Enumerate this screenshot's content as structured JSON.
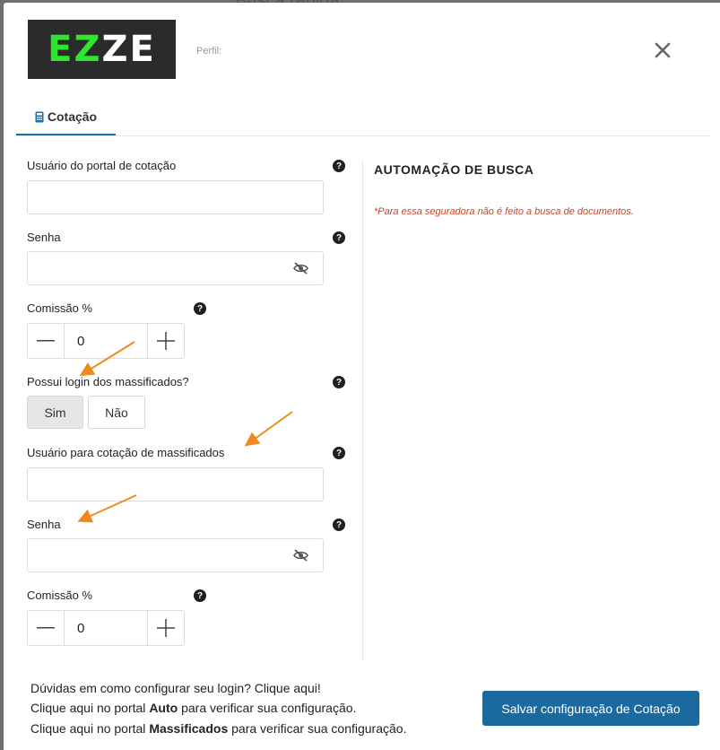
{
  "backdrop": {
    "search_label": "Busca rápida"
  },
  "header": {
    "logo_text_1": "EZ",
    "logo_text_2": "ZE",
    "perfil_label": "Perfil:"
  },
  "tabs": [
    {
      "label": "Cotação",
      "icon": "calculator-icon"
    }
  ],
  "form": {
    "usuario_label": "Usuário do portal de cotação",
    "usuario_value": "",
    "senha_label": "Senha",
    "senha_value": "",
    "comissao_label": "Comissão %",
    "comissao_value": "0",
    "massificados_question": "Possui login dos massificados?",
    "options": [
      "Sim",
      "Não"
    ],
    "selected_option": "Sim",
    "usuario_massificados_label": "Usuário para cotação de massificados",
    "usuario_massificados_value": "",
    "senha2_label": "Senha",
    "senha2_value": "",
    "comissao2_label": "Comissão %",
    "comissao2_value": "0"
  },
  "automation": {
    "title": "AUTOMAÇÃO DE BUSCA",
    "note": "*Para essa seguradora não é feito a busca de documentos."
  },
  "footer": {
    "line1": "Dúvidas em como configurar seu login? Clique aqui!",
    "line2_pre": "Clique aqui no portal ",
    "line2_bold": "Auto",
    "line2_post": " para verificar sua configuração.",
    "line3_pre": "Clique aqui no portal ",
    "line3_bold": "Massificados",
    "line3_post": " para verificar sua configuração.",
    "save_label": "Salvar configuração de Cotação"
  },
  "colors": {
    "accent": "#1a6aa0",
    "arrow": "#f08a1e",
    "note": "#c9442a"
  }
}
